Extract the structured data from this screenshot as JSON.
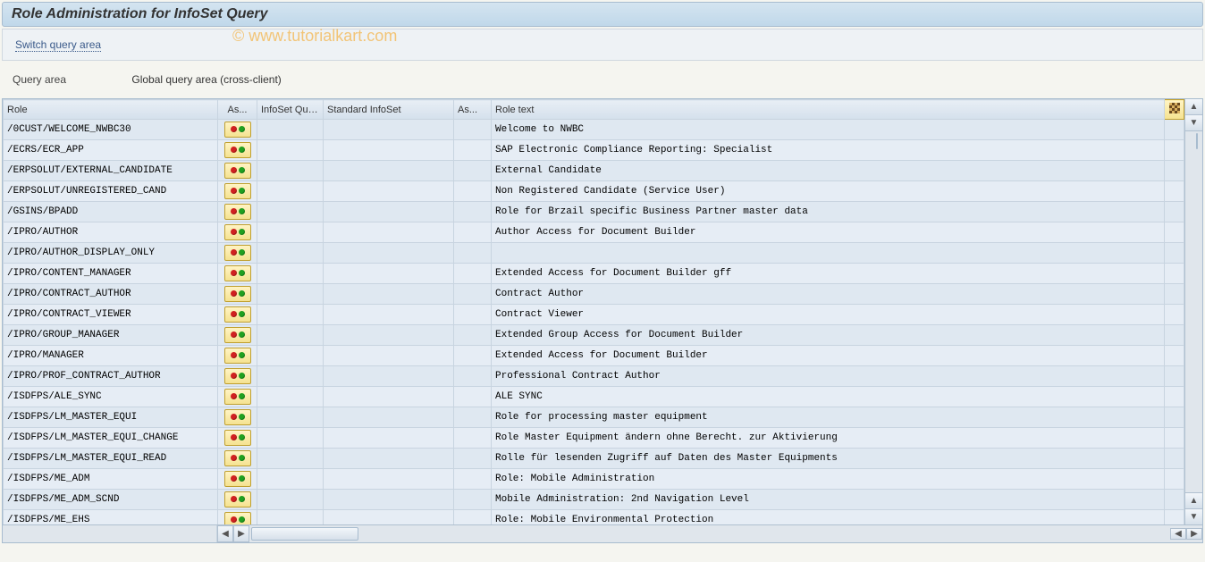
{
  "title": "Role Administration for InfoSet Query",
  "toolbar": {
    "switch_area": "Switch query area"
  },
  "watermark": "© www.tutorialkart.com",
  "query_area": {
    "label": "Query area",
    "value": "Global query area (cross-client)"
  },
  "columns": {
    "role": "Role",
    "assign": "As...",
    "infoset_query": "InfoSet Quer...",
    "standard_infoset": "Standard InfoSet",
    "assign2": "As...",
    "role_text": "Role text"
  },
  "rows": [
    {
      "role": "/0CUST/WELCOME_NWBC30",
      "text": "Welcome to  NWBC"
    },
    {
      "role": "/ECRS/ECR_APP",
      "text": "SAP Electronic Compliance Reporting: Specialist"
    },
    {
      "role": "/ERPSOLUT/EXTERNAL_CANDIDATE",
      "text": "External Candidate"
    },
    {
      "role": "/ERPSOLUT/UNREGISTERED_CAND",
      "text": "Non Registered Candidate (Service User)"
    },
    {
      "role": "/GSINS/BPADD",
      "text": "Role for Brzail specific Business Partner master data"
    },
    {
      "role": "/IPRO/AUTHOR",
      "text": "Author Access for Document Builder"
    },
    {
      "role": "/IPRO/AUTHOR_DISPLAY_ONLY",
      "text": ""
    },
    {
      "role": "/IPRO/CONTENT_MANAGER",
      "text": "Extended Access for Document Builder  gff"
    },
    {
      "role": "/IPRO/CONTRACT_AUTHOR",
      "text": "Contract Author"
    },
    {
      "role": "/IPRO/CONTRACT_VIEWER",
      "text": "Contract Viewer"
    },
    {
      "role": "/IPRO/GROUP_MANAGER",
      "text": "Extended Group Access for Document Builder"
    },
    {
      "role": "/IPRO/MANAGER",
      "text": "Extended Access for Document Builder"
    },
    {
      "role": "/IPRO/PROF_CONTRACT_AUTHOR",
      "text": "Professional Contract Author"
    },
    {
      "role": "/ISDFPS/ALE_SYNC",
      "text": "ALE SYNC"
    },
    {
      "role": "/ISDFPS/LM_MASTER_EQUI",
      "text": "Role for processing master equipment"
    },
    {
      "role": "/ISDFPS/LM_MASTER_EQUI_CHANGE",
      "text": "Role Master Equipment ändern ohne Berecht. zur Aktivierung"
    },
    {
      "role": "/ISDFPS/LM_MASTER_EQUI_READ",
      "text": "Rolle für lesenden Zugriff auf Daten des Master Equipments"
    },
    {
      "role": "/ISDFPS/ME_ADM",
      "text": "Role: Mobile Administration"
    },
    {
      "role": "/ISDFPS/ME_ADM_SCND",
      "text": "Mobile Administration: 2nd Navigation Level"
    },
    {
      "role": "/ISDFPS/ME_EHS",
      "text": "Role: Mobile Environmental Protection"
    }
  ]
}
